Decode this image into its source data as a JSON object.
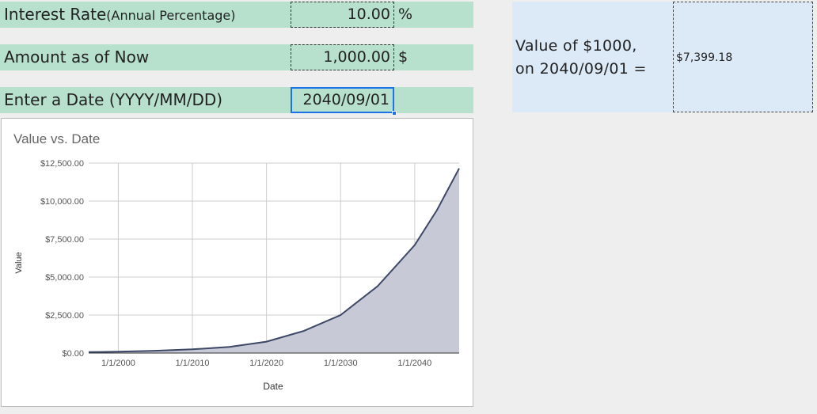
{
  "inputs": {
    "rate": {
      "label": "Interest Rate",
      "label_suffix": "(Annual Percentage)",
      "value": "10.00",
      "unit": "%"
    },
    "amount": {
      "label": "Amount as of Now",
      "value": "1,000.00",
      "unit": "$"
    },
    "date": {
      "label": "Enter a Date (YYYY/MM/DD)",
      "value": "2040/09/01"
    }
  },
  "result": {
    "line1": "Value of $1000,",
    "line2": "on 2040/09/01 =",
    "value": "$7,399.18"
  },
  "colors": {
    "input_row_bg": "#b7e1cd",
    "result_bg": "#dce9f7",
    "series_line": "#3d4766",
    "series_fill": "#c7cad6",
    "selection": "#1a73e8"
  },
  "chart_data": {
    "type": "area",
    "title": "Value vs. Date",
    "xlabel": "Date",
    "ylabel": "Value",
    "ylim": [
      0,
      12500
    ],
    "yticks": [
      "$12,500.00",
      "$10,000.00",
      "$7,500.00",
      "$5,000.00",
      "$2,500.00",
      "$0.00"
    ],
    "ytick_values": [
      12500,
      10000,
      7500,
      5000,
      2500,
      0
    ],
    "xticks": [
      "1/1/2000",
      "1/1/2010",
      "1/1/2020",
      "1/1/2030",
      "1/1/2040"
    ],
    "xtick_years": [
      2000,
      2010,
      2020,
      2030,
      2040
    ],
    "xlim": [
      1996,
      2046
    ],
    "grid": true,
    "series": [
      {
        "x": [
          1996,
          2000,
          2005,
          2010,
          2015,
          2020,
          2025,
          2030,
          2035,
          2040,
          2043,
          2046
        ],
        "values": [
          60,
          90,
          150,
          245,
          400,
          750,
          1450,
          2500,
          4400,
          7100,
          9400,
          12150
        ]
      }
    ]
  }
}
